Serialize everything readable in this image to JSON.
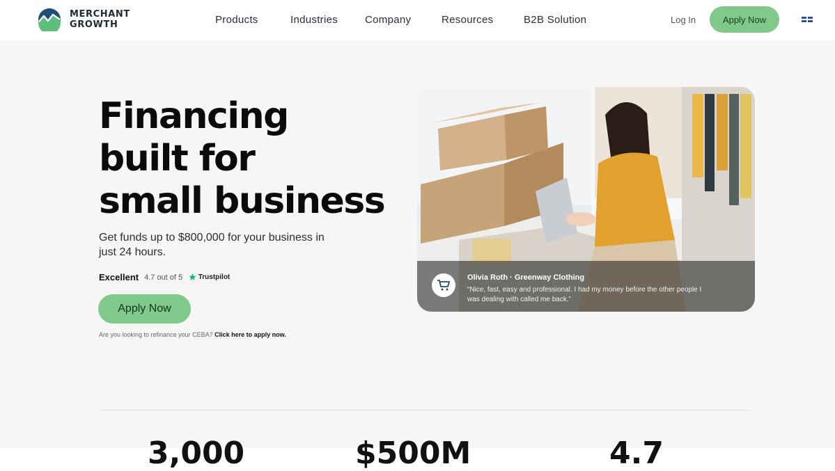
{
  "brand": {
    "line1": "MERCHANT",
    "line2": "GROWTH"
  },
  "nav": [
    {
      "label": "Products"
    },
    {
      "label": "Industries"
    },
    {
      "label": "Company"
    },
    {
      "label": "Resources"
    },
    {
      "label": "B2B Solution"
    }
  ],
  "header": {
    "login_label": "Log In",
    "apply_label": "Apply Now"
  },
  "hero": {
    "headline": [
      "Financing",
      "built for",
      "small business"
    ],
    "subtext": "Get funds up to $800,000 for your business in just 24 hours.",
    "rating_label": "Excellent",
    "rating_score": "4.7 out of 5",
    "rating_source": "Trustpilot",
    "cta_label": "Apply Now",
    "ceba_text": "Are you looking to refinance your CEBA?",
    "ceba_link": "Click here to apply now."
  },
  "testimonial": {
    "name": "Olivia Roth · Greenway Clothing",
    "quote": "“Nice, fast, easy and professional. I had my money before the other people I was dealing with called me back.”"
  },
  "stats": [
    {
      "value": "3,000"
    },
    {
      "value": "$500M"
    },
    {
      "value": "4.7"
    }
  ],
  "colors": {
    "accent_green": "#7fc98b",
    "brand_blue": "#1f4e79",
    "trustpilot": "#00b67a"
  }
}
